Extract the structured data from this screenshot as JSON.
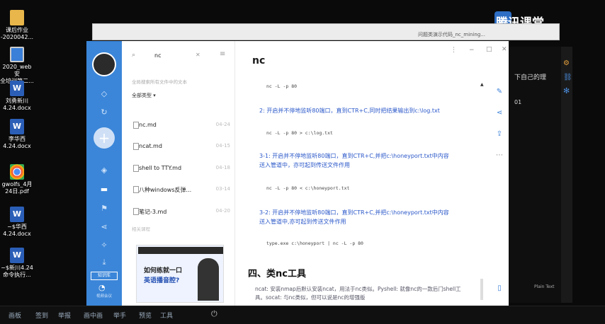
{
  "desktop_icons": [
    {
      "label": "课后作业\n-2020042...",
      "type": "folder"
    },
    {
      "label": "2020_web安\n全培训第二...",
      "type": "monitor"
    },
    {
      "label": "刘勇新川\n4.24.docx",
      "type": "word"
    },
    {
      "label": "李华西\n4.24.docx",
      "type": "word"
    },
    {
      "label": "gwolfs_4月\n24日.pdf",
      "type": "chrome"
    },
    {
      "label": "~$华西\n4.24.docx",
      "type": "word"
    },
    {
      "label": "~$新川4.24\n命令执行...",
      "type": "word"
    }
  ],
  "tencent": {
    "label": "腾讯课堂"
  },
  "back_window": {
    "title": "问题类演示代码_nc_mining..."
  },
  "sidebar": {
    "icons": [
      "diamond-icon",
      "sync-icon",
      "add-icon",
      "layers-icon",
      "folder-icon",
      "flag-icon",
      "share-icon",
      "wand-icon",
      "download-icon"
    ],
    "bottom_label": "知识库",
    "bottom_caption": "视频会议"
  },
  "file_panel": {
    "search_value": "nc",
    "hint": "全局搜索所有文件中的文本",
    "filter": "全部类型",
    "files": [
      {
        "name": "nc.md",
        "time": "04-24"
      },
      {
        "name": "ncat.md",
        "time": "04-15"
      },
      {
        "name": "shell to TTY.md",
        "time": "04-18"
      },
      {
        "name": "八种windows反弹...",
        "time": "03-14"
      },
      {
        "name": "笔记-3.md",
        "time": "04-20"
      }
    ],
    "section": "相关课程",
    "ad": {
      "line1": "如何练就一口",
      "line2": "英语播音腔?"
    }
  },
  "document": {
    "title": "nc",
    "code1": "nc -L -p 80",
    "para2": "2: 开启并不停地监听80端口，直到CTR+C,同时把结果输出到c:\\log.txt",
    "code2": "nc -L -p 80 > c:\\log.txt",
    "para3a": "3-1: 开启并不停地监听80端口，直到CTR+C,并把c:\\honeyport.txt中内容",
    "para3b": "送入管道中，亦可起到传送文件作用",
    "code3": "nc -L -p 80 < c:\\honeyport.txt",
    "para4a": "3-2: 开启并不停地监听80端口，直到CTR+C,并把c:\\honeyport.txt中内容",
    "para4b": "送入管道中,亦可起到传送文件作用",
    "code4": "type.exe c:\\honeyport | nc -L -p 80",
    "heading": "四、类nc工具",
    "body": "ncat: 安装nmap后默认安装ncat，用法于nc类似。Pyshell: 就像nc的一款后门shell工具。socat: 与nc类似，但可以说是nc的增强版"
  },
  "right_panel": {
    "snippet": "下自己的理",
    "code": "01",
    "tiny": "Plain Text"
  },
  "taskbar": {
    "items": [
      "画板",
      "签到",
      "举报",
      "画中画",
      "举手",
      "预览",
      "工具"
    ]
  }
}
